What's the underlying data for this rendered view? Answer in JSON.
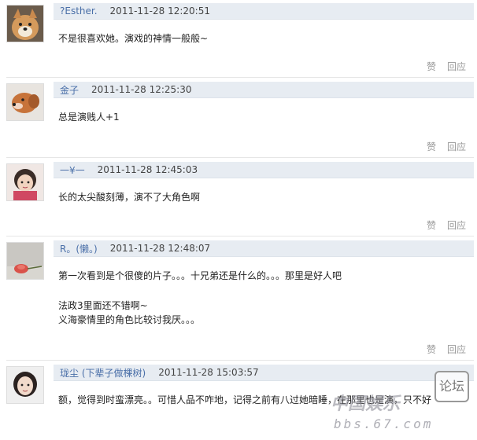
{
  "comments": [
    {
      "name": "?Esther.",
      "time": "2011-11-28 12:20:51",
      "lines": [
        "不是很喜欢她。演戏的神情一般般~"
      ],
      "like": "赞",
      "reply": "回应"
    },
    {
      "name": "金子",
      "time": "2011-11-28 12:25:30",
      "lines": [
        "总是演贱人+1"
      ],
      "like": "赞",
      "reply": "回应"
    },
    {
      "name": "一¥一",
      "time": "2011-11-28 12:45:03",
      "lines": [
        "长的太尖酸刻薄，演不了大角色啊"
      ],
      "like": "赞",
      "reply": "回应"
    },
    {
      "name": "R。(懒。)",
      "time": "2011-11-28 12:48:07",
      "lines": [
        "第一次看到是个很傻的片子。。。十兄弟还是什么的。。。那里是好人吧",
        "",
        "法政3里面还不错啊~",
        "义海豪情里的角色比较讨我厌。。。"
      ],
      "like": "赞",
      "reply": "回应"
    },
    {
      "name": "珑尘 (下辈子做棵树)",
      "time": "2011-11-28 15:03:57",
      "lines": [
        "额，觉得到时蛮漂亮。。可惜人品不咋地，记得之前有八过她暗睡，在那里也是演，只不好"
      ],
      "like": "",
      "reply": ""
    }
  ],
  "watermark": {
    "line1": "论坛",
    "line2": "中国娱乐",
    "line3": "bbs.67.com"
  }
}
